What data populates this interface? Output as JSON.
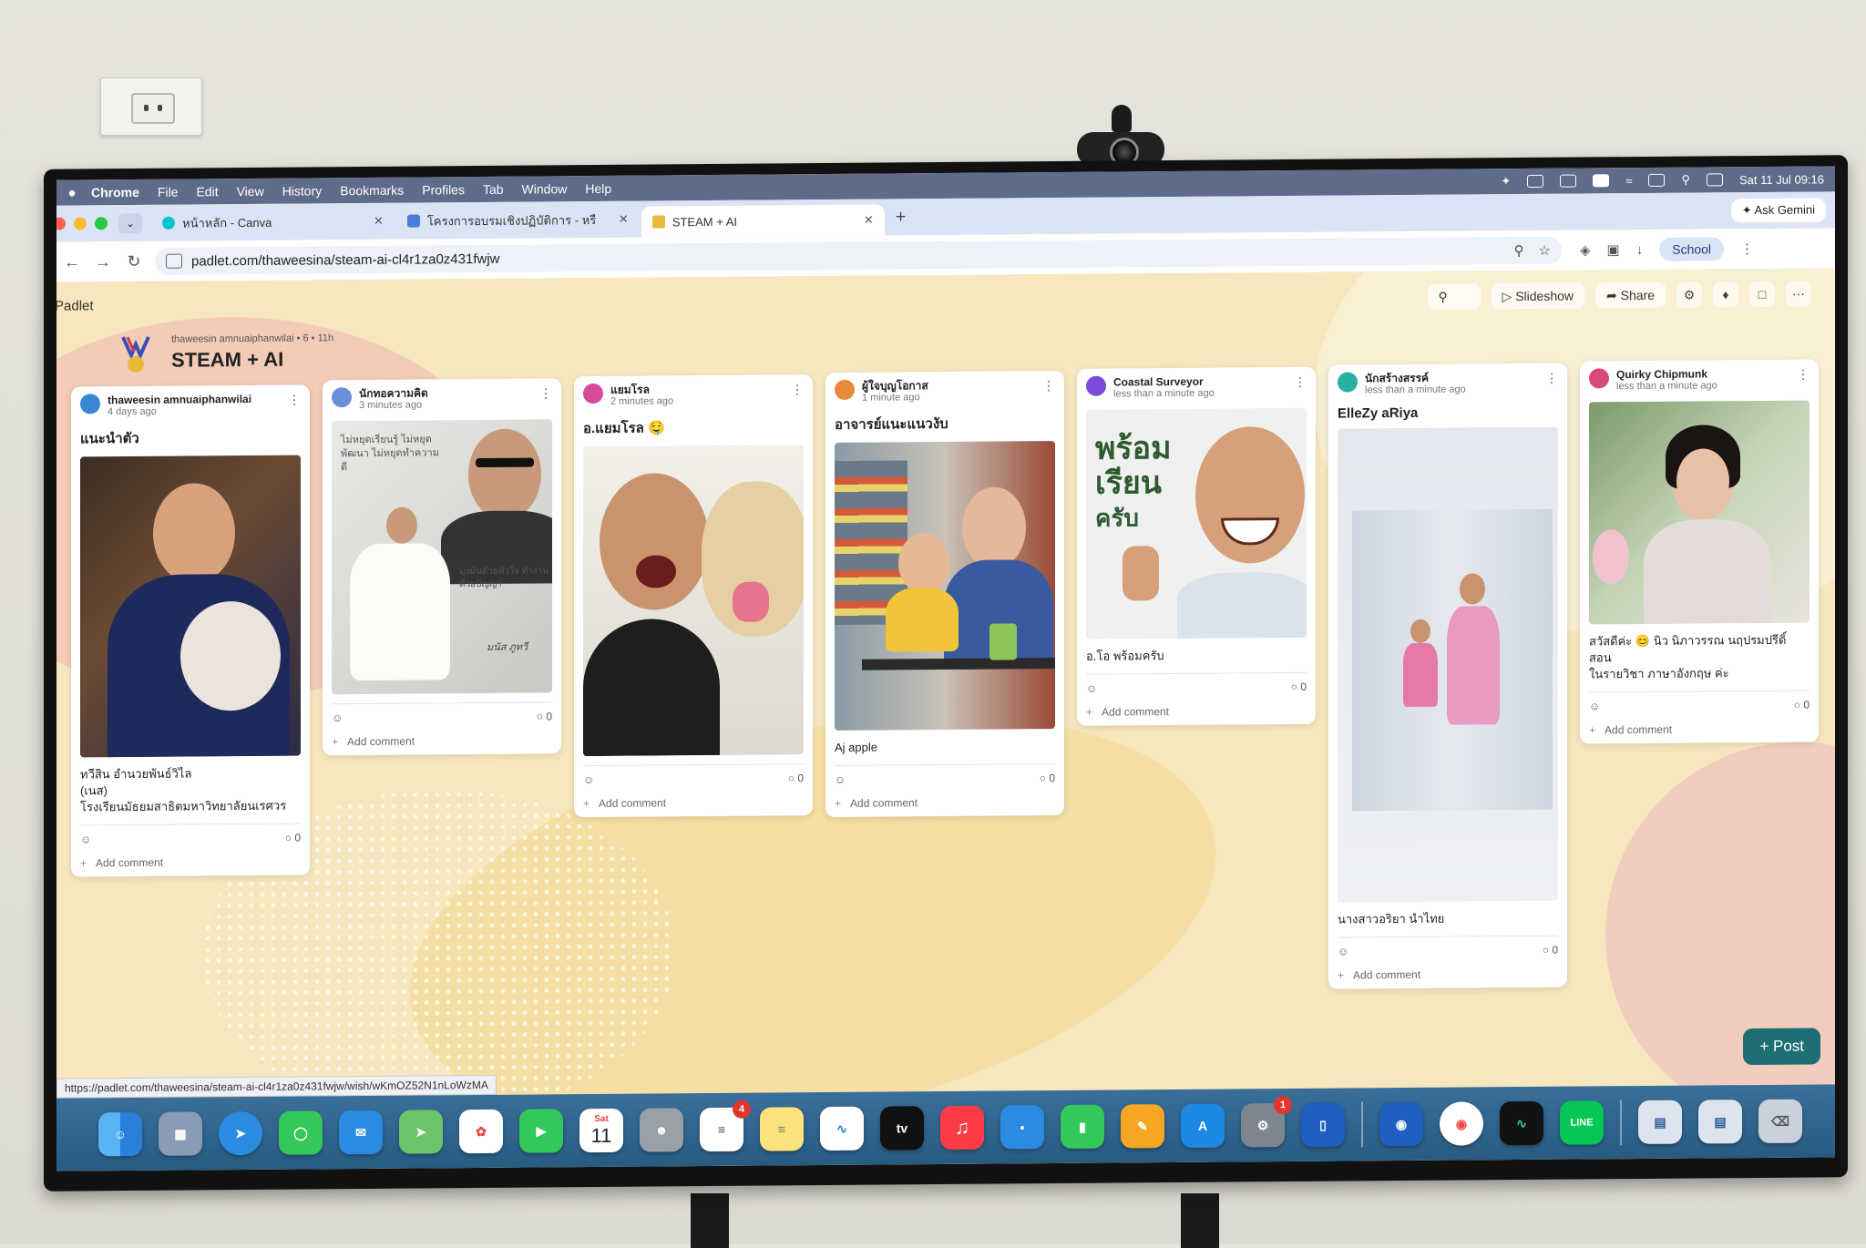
{
  "menubar": {
    "items": [
      "Chrome",
      "File",
      "Edit",
      "View",
      "History",
      "Bookmarks",
      "Profiles",
      "Tab",
      "Window",
      "Help"
    ],
    "datetime": "Sat 11 Jul 09:16"
  },
  "tabs": [
    {
      "title": "หน้าหลัก - Canva",
      "color": "#00c4cc"
    },
    {
      "title": "โครงการอบรมเชิงปฏิบัติการ - หรื",
      "color": "#4a7bd8"
    },
    {
      "title": "STEAM + AI",
      "color": "#e8b93a"
    }
  ],
  "ask_gemini": "Ask Gemini",
  "address": "padlet.com/thaweesina/steam-ai-cl4r1za0z431fwjw",
  "profile": "School",
  "padlet": {
    "brand": "Padlet",
    "meta": "thaweesin amnuaiphanwilai • 6 • 11h",
    "title": "STEAM + AI",
    "slideshow": "Slideshow",
    "share": "Share",
    "post_button": "+ Post",
    "status_url": "https://padlet.com/thaweesina/steam-ai-cl4r1za0z431fwjw/wish/wKmOZ52N1nLoWzMA",
    "posts": [
      {
        "author": "thaweesin amnuaiphanwilai",
        "time": "4 days ago",
        "title": "แนะนำตัว",
        "body": [
          "ทวีสิน อำนวยพันธ์วิไล",
          "(เนส)",
          "โรงเรียนมัธยมสาธิตมหาวิทยาลัยนเรศวร"
        ],
        "comments": "0",
        "add": "Add comment",
        "avatar": "#3a86d4"
      },
      {
        "author": "นักทอความคิด",
        "time": "3 minutes ago",
        "title": "",
        "body": [],
        "comments": "0",
        "add": "Add comment",
        "avatar": "#6a8fd8",
        "quote1": "ไม่หยุดเรียนรู้ ไม่หยุดพัฒนา ไม่หยุดทำความดี",
        "quote2": "มุ่งมั่นด้วยหัวใจ ทำงานด้วยปัญญา",
        "sign": "มนัส ภูทวี"
      },
      {
        "author": "แยมโรล",
        "time": "2 minutes ago",
        "title": "อ.แยมโรล 🤤",
        "body": [],
        "comments": "0",
        "add": "Add comment",
        "avatar": "#d84a9b"
      },
      {
        "author": "ผู้ใจบุญโอกาส",
        "time": "1 minute ago",
        "title": "อาจารย์แนะแนวงับ",
        "body": [
          "Aj apple"
        ],
        "comments": "0",
        "add": "Add comment",
        "avatar": "#e88a3a"
      },
      {
        "author": "Coastal Surveyor",
        "time": "less than a minute ago",
        "title": "",
        "body": [
          "อ.โอ พร้อมครับ"
        ],
        "comments": "0",
        "add": "Add comment",
        "avatar": "#7a4ad8",
        "sticker": [
          "พร้อม",
          "เรียน",
          "ครับ"
        ]
      },
      {
        "author": "นักสร้างสรรค์",
        "time": "less than a minute ago",
        "title": "ElleZy aRiya",
        "body": [
          "นางสาวอริยา นำไทย"
        ],
        "comments": "0",
        "add": "Add comment",
        "avatar": "#2ab0a0"
      },
      {
        "author": "Quirky Chipmunk",
        "time": "less than a minute ago",
        "title": "",
        "body": [
          "สวัสดีค่ะ 😊 นิว นิภาวรรณ นฤปรมปรีดิ์ สอน",
          "ในรายวิชา ภาษาอังกฤษ ค่ะ"
        ],
        "comments": "0",
        "add": "Add comment",
        "avatar": "#d84a7a"
      }
    ]
  },
  "dock": {
    "calendar_day": "Sat",
    "calendar_date": "11",
    "reminders_badge": "4",
    "settings_badge": "1",
    "tv_label": "tv",
    "line_label": "LINE"
  }
}
